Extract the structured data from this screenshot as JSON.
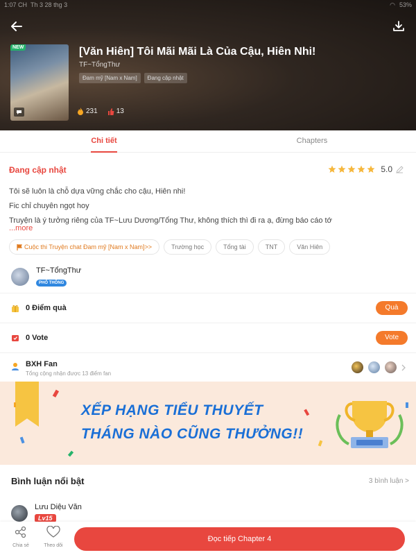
{
  "statusbar": {
    "time": "1:07 CH",
    "date": "Th 3 28 thg 3",
    "battery": "53%"
  },
  "book": {
    "title": "[Văn Hiên] Tôi Mãi Mãi Là Của Cậu, Hiên Nhi!",
    "author": "TF~TổngThư",
    "new_badge": "NEW",
    "tags": [
      "Đam mỹ [Nam x Nam]",
      "Đang cập nhật"
    ],
    "fires": "231",
    "likes": "13"
  },
  "tabs": [
    {
      "label": "Chi tiết",
      "active": true
    },
    {
      "label": "Chapters",
      "active": false
    }
  ],
  "details": {
    "status": "Đang cập nhật",
    "rating": "5.0",
    "stars": 5,
    "description": [
      "Tôi sẽ luôn là chỗ dựa vững chắc cho cậu, Hiên nhi!",
      "Fic chỉ chuyên ngọt hoy",
      "Truyện là ý tưởng riêng của TF~Lưu Dương/Tổng Thư, không thích thì đi ra ạ, đừng báo cáo tớ"
    ],
    "more": "...more",
    "chips": [
      "Cuộc thi Truyện chat Đam mỹ [Nam x Nam]>>",
      "Trường học",
      "Tổng tài",
      "TNT",
      "Văn Hiên"
    ]
  },
  "author_row": {
    "name": "TF~TổngThư",
    "badge": "PHỔ THÔNG"
  },
  "gift": {
    "label": "0 Điểm quà",
    "button": "Quà"
  },
  "vote": {
    "label": "0 Vote",
    "button": "Vote"
  },
  "fan": {
    "title": "BXH Fan",
    "subtitle": "Tổng cộng nhận được 13 điểm fan"
  },
  "banner": {
    "line1": "XẾP HẠNG TIỂU THUYẾT",
    "line2": "THÁNG NÀO CŨNG THƯỞNG!!"
  },
  "comments": {
    "title": "Bình luận nổi bật",
    "count": "3 bình luận >",
    "commenter": "Lưu Diệu Văn",
    "level": "Lv15"
  },
  "bottom": {
    "share": "Chia sẻ",
    "follow": "Theo dõi",
    "read": "Đọc tiếp Chapter 4"
  },
  "colors": {
    "accent": "#e8473f",
    "orange": "#f47a2b",
    "blue": "#1a6fd6"
  }
}
